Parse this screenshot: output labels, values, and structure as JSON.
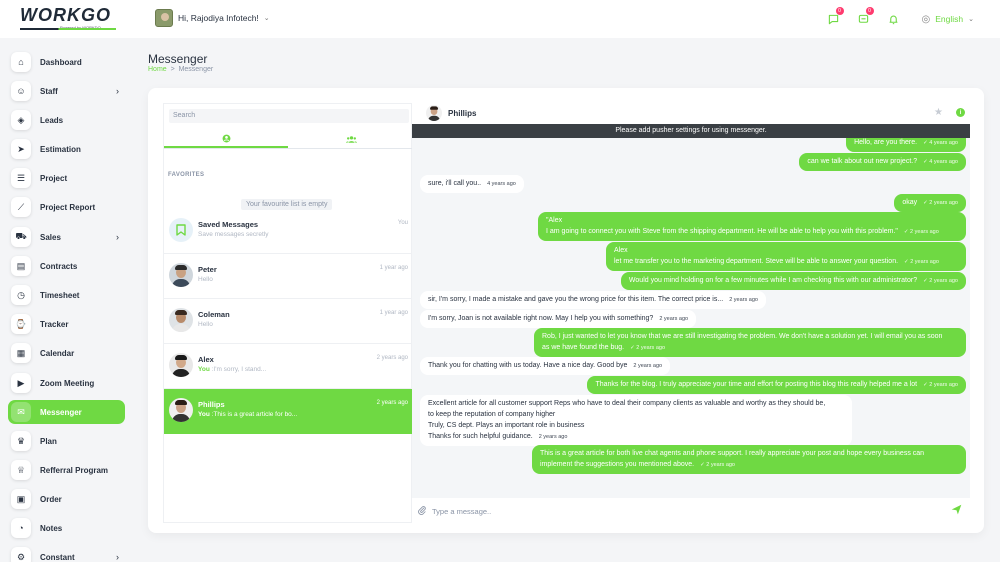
{
  "app": {
    "logo_text": "WORKGO",
    "logo_sub": "Powered by WORKDO"
  },
  "header": {
    "greeting": "Hi, Rajodiya Infotech!",
    "chat_badge": "0",
    "msg_badge": "0",
    "language": "English"
  },
  "sidebar": {
    "items": [
      {
        "label": "Dashboard",
        "icon": "home-icon",
        "arrow": false
      },
      {
        "label": "Staff",
        "icon": "users-icon",
        "arrow": true
      },
      {
        "label": "Leads",
        "icon": "box-icon",
        "arrow": false
      },
      {
        "label": "Estimation",
        "icon": "send-icon",
        "arrow": false
      },
      {
        "label": "Project",
        "icon": "list-icon",
        "arrow": false
      },
      {
        "label": "Project Report",
        "icon": "chart-icon",
        "arrow": false
      },
      {
        "label": "Sales",
        "icon": "cart-icon",
        "arrow": true
      },
      {
        "label": "Contracts",
        "icon": "contract-icon",
        "arrow": false
      },
      {
        "label": "Timesheet",
        "icon": "clock-icon",
        "arrow": false
      },
      {
        "label": "Tracker",
        "icon": "watch-icon",
        "arrow": false
      },
      {
        "label": "Calendar",
        "icon": "calendar-icon",
        "arrow": false
      },
      {
        "label": "Zoom Meeting",
        "icon": "video-icon",
        "arrow": false
      },
      {
        "label": "Messenger",
        "icon": "messenger-icon",
        "arrow": false,
        "active": true
      },
      {
        "label": "Plan",
        "icon": "trophy-icon",
        "arrow": false
      },
      {
        "label": "Refferral Program",
        "icon": "award-icon",
        "arrow": false
      },
      {
        "label": "Order",
        "icon": "order-icon",
        "arrow": false
      },
      {
        "label": "Notes",
        "icon": "notes-icon",
        "arrow": false
      },
      {
        "label": "Constant",
        "icon": "settings-icon",
        "arrow": true
      }
    ]
  },
  "page": {
    "title": "Messenger",
    "breadcrumb_home": "Home",
    "breadcrumb_sep": ">",
    "breadcrumb_current": "Messenger"
  },
  "contacts_panel": {
    "search_placeholder": "Search",
    "favorites_title": "FAVORITES",
    "favorites_empty": "Your favourite list is empty",
    "contacts": [
      {
        "name": "Saved Messages",
        "sub": "Save messages secretly",
        "time": "You",
        "type": "saved"
      },
      {
        "name": "Peter",
        "sub": "Hello",
        "time": "1 year ago"
      },
      {
        "name": "Coleman",
        "sub": "Hello",
        "time": "1 year ago"
      },
      {
        "name": "Alex",
        "you": "You",
        "sub": " :I'm sorry, I stand...",
        "time": "2 years ago"
      },
      {
        "name": "Phillips",
        "you": "You",
        "sub": " :This is a great article for bo...",
        "time": "2 years ago",
        "active": true
      }
    ]
  },
  "chat": {
    "contact_name": "Phillips",
    "pusher_notice": "Please add pusher settings for using messenger.",
    "composer_placeholder": "Type a message..",
    "messages": [
      {
        "from": "me",
        "lines": [
          "Hello, are you there."
        ],
        "time": "4 years ago"
      },
      {
        "from": "me",
        "lines": [
          "can we talk about out new project.?"
        ],
        "time": "4 years ago"
      },
      {
        "from": "them",
        "lines": [
          "sure, i'll call you.."
        ],
        "time": "4 years ago"
      },
      {
        "from": "me",
        "lines": [
          "okay"
        ],
        "time": "2 years ago"
      },
      {
        "from": "me",
        "lines": [
          "\"Alex",
          "  I am going to connect you with Steve from the shipping department. He will be able to help you with this problem.\""
        ],
        "time": "2 years ago"
      },
      {
        "from": "me",
        "lines": [
          "Alex",
          "  let me transfer you to the marketing department. Steve will be able to answer your question."
        ],
        "time": "2 years ago"
      },
      {
        "from": "me",
        "lines": [
          "Would you mind holding on for a few minutes while I am checking this with our administrator?"
        ],
        "time": "2 years ago"
      },
      {
        "from": "them",
        "lines": [
          "sir, I'm sorry, I made a mistake and gave you the wrong price for this item. The correct price is..."
        ],
        "time": "2 years ago"
      },
      {
        "from": "them",
        "lines": [
          "I'm sorry, Joan is not available right now. May I help you with something?"
        ],
        "time": "2 years ago"
      },
      {
        "from": "me",
        "lines": [
          "Rob, I just wanted to let you know that we are still investigating the problem. We don't have a solution yet. I will email you as soon",
          "as we have found the bug."
        ],
        "time": "2 years ago"
      },
      {
        "from": "them",
        "lines": [
          "Thank you for chatting with us today. Have a nice day. Good bye"
        ],
        "time": "2 years ago"
      },
      {
        "from": "me",
        "lines": [
          "Thanks for the blog. I truly appreciate your time and effort for posting this blog this really helped me a lot"
        ],
        "time": "2 years ago"
      },
      {
        "from": "them",
        "lines": [
          "Excellent article for all customer support Reps who have to deal their company clients as valuable and worthy as they should be,",
          "to keep the reputation of company higher",
          "Truly, CS dept. Plays an important role in business",
          "Thanks for such helpful guidance."
        ],
        "time": "2 years ago"
      },
      {
        "from": "me",
        "lines": [
          "This is a great article for both live chat agents and phone support. I really appreciate your post and hope every business can",
          "implement the suggestions you mentioned above."
        ],
        "time": "2 years ago"
      }
    ]
  },
  "colors": {
    "accent": "#6fd943",
    "text": "#293240",
    "muted": "#8a94a6",
    "badge": "#ff3a6e",
    "notice_bg": "#3a3f44"
  }
}
